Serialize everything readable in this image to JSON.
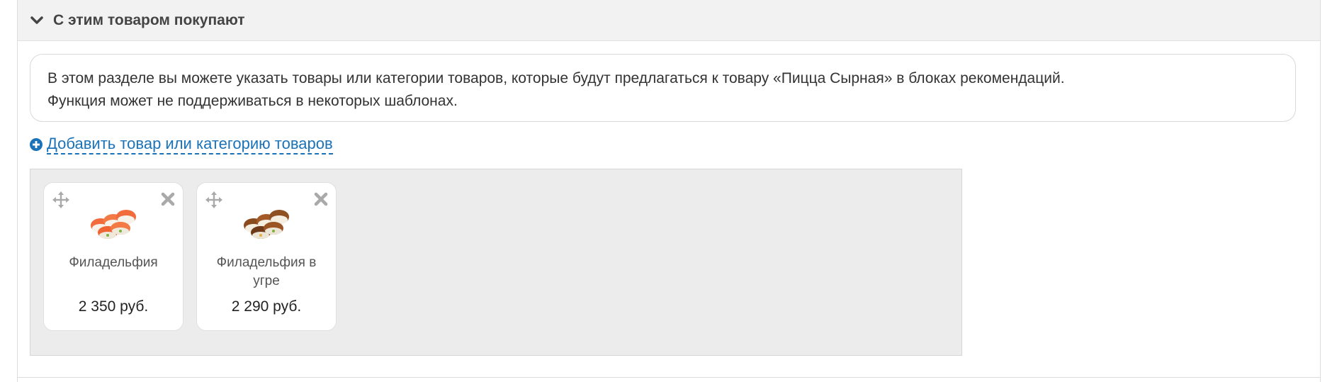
{
  "section": {
    "title": "С этим товаром покупают",
    "info": {
      "line1": "В этом разделе вы можете указать товары или категории товаров, которые будут предлагаться к товару «Пицца Сырная» в блоках рекомендаций.",
      "line2": "Функция может не поддерживаться в некоторых шаблонах."
    },
    "add_link": "Добавить товар или категорию товаров",
    "products": [
      {
        "name": "Филадельфия",
        "price": "2 350 руб.",
        "image": "sushi-rolls-salmon-icon"
      },
      {
        "name": "Филадельфия в угре",
        "price": "2 290 руб.",
        "image": "sushi-rolls-eel-icon"
      }
    ]
  },
  "icons": {
    "toggle": "chevron-down-icon",
    "add": "plus-circle-icon",
    "move": "move-arrows-icon",
    "remove": "close-icon"
  },
  "colors": {
    "link": "#1a73b8",
    "header_bg": "#f2f2f2",
    "area_bg": "#ececec"
  }
}
